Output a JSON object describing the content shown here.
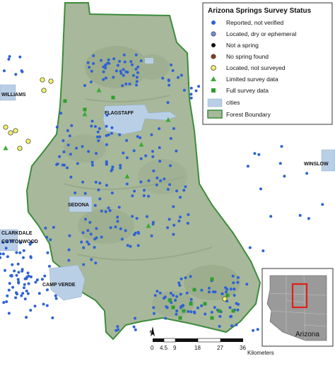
{
  "legend": {
    "title": "Arizona Springs Survey Status",
    "items": [
      {
        "label": "Reported, not verified",
        "symbol": "circle",
        "color": "#2f62d6"
      },
      {
        "label": "Located, dry or ephemeral",
        "symbol": "circle",
        "color": "#6f8fe0"
      },
      {
        "label": "Not a spring",
        "symbol": "circle",
        "color": "#111111"
      },
      {
        "label": "No spring found",
        "symbol": "circle",
        "color": "#8b3a1f"
      },
      {
        "label": "Located, not surveyed",
        "symbol": "circle",
        "color": "#f4f06a"
      },
      {
        "label": "Limited survey data",
        "symbol": "triangle",
        "color": "#3aaa35"
      },
      {
        "label": "Full survey data",
        "symbol": "square",
        "color": "#2e9e2a"
      },
      {
        "label": "cities",
        "symbol": "rect",
        "color": "#b9cfe6"
      },
      {
        "label": "Forest Boundary",
        "symbol": "outline",
        "color": "#3c8c3c"
      }
    ]
  },
  "cities": [
    {
      "name": "FLAGSTAFF"
    },
    {
      "name": "WILLIAMS"
    },
    {
      "name": "SEDONA"
    },
    {
      "name": "CLARKDALE"
    },
    {
      "name": "COTTONWOOD"
    },
    {
      "name": "CAMP VERDE"
    },
    {
      "name": "WINSLOW"
    }
  ],
  "scale": {
    "ticks": [
      "0",
      "4.5",
      "9",
      "18",
      "27",
      "36"
    ],
    "unit": "Kilometers"
  },
  "inset": {
    "label": "Arizona"
  },
  "colors": {
    "forest_fill": "#a8b89a",
    "forest_outline": "#3c8c3c",
    "city_fill": "#b9cfe6",
    "reported": "#2f62d6",
    "located_not_surveyed": "#f4f06a",
    "limited_survey": "#3aaa35",
    "full_survey": "#2e9e2a",
    "inset_highlight": "#e0201a"
  }
}
